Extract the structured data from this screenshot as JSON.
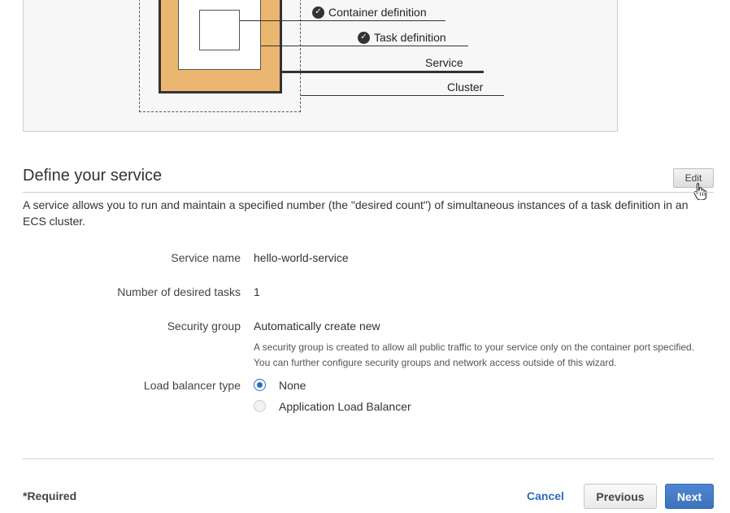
{
  "diagram": {
    "labels": {
      "container_definition": "Container definition",
      "task_definition": "Task definition",
      "service": "Service",
      "cluster": "Cluster"
    },
    "icons": {
      "completed": "check-circle-icon"
    }
  },
  "service_section": {
    "title": "Define your service",
    "edit_label": "Edit",
    "description": "A service allows you to run and maintain a specified number (the \"desired count\") of simultaneous instances of a task definition in an ECS cluster.",
    "fields": {
      "service_name": {
        "label": "Service name",
        "value": "hello-world-service"
      },
      "desired_tasks": {
        "label": "Number of desired tasks",
        "value": "1"
      },
      "security_group": {
        "label": "Security group",
        "value": "Automatically create new",
        "help_line_1": "A security group is created to allow all public traffic to your service only on the container port specified.",
        "help_line_2": "You can further configure security groups and network access outside of this wizard."
      },
      "load_balancer": {
        "label": "Load balancer type",
        "options": [
          {
            "label": "None",
            "selected": true
          },
          {
            "label": "Application Load Balancer",
            "selected": false
          }
        ]
      }
    }
  },
  "footer": {
    "required_label": "*Required",
    "cancel_label": "Cancel",
    "previous_label": "Previous",
    "next_label": "Next"
  },
  "colors": {
    "accent": "#2d6cc0",
    "service_fill": "#ebb66f",
    "primary_button": "#3d73bd"
  }
}
